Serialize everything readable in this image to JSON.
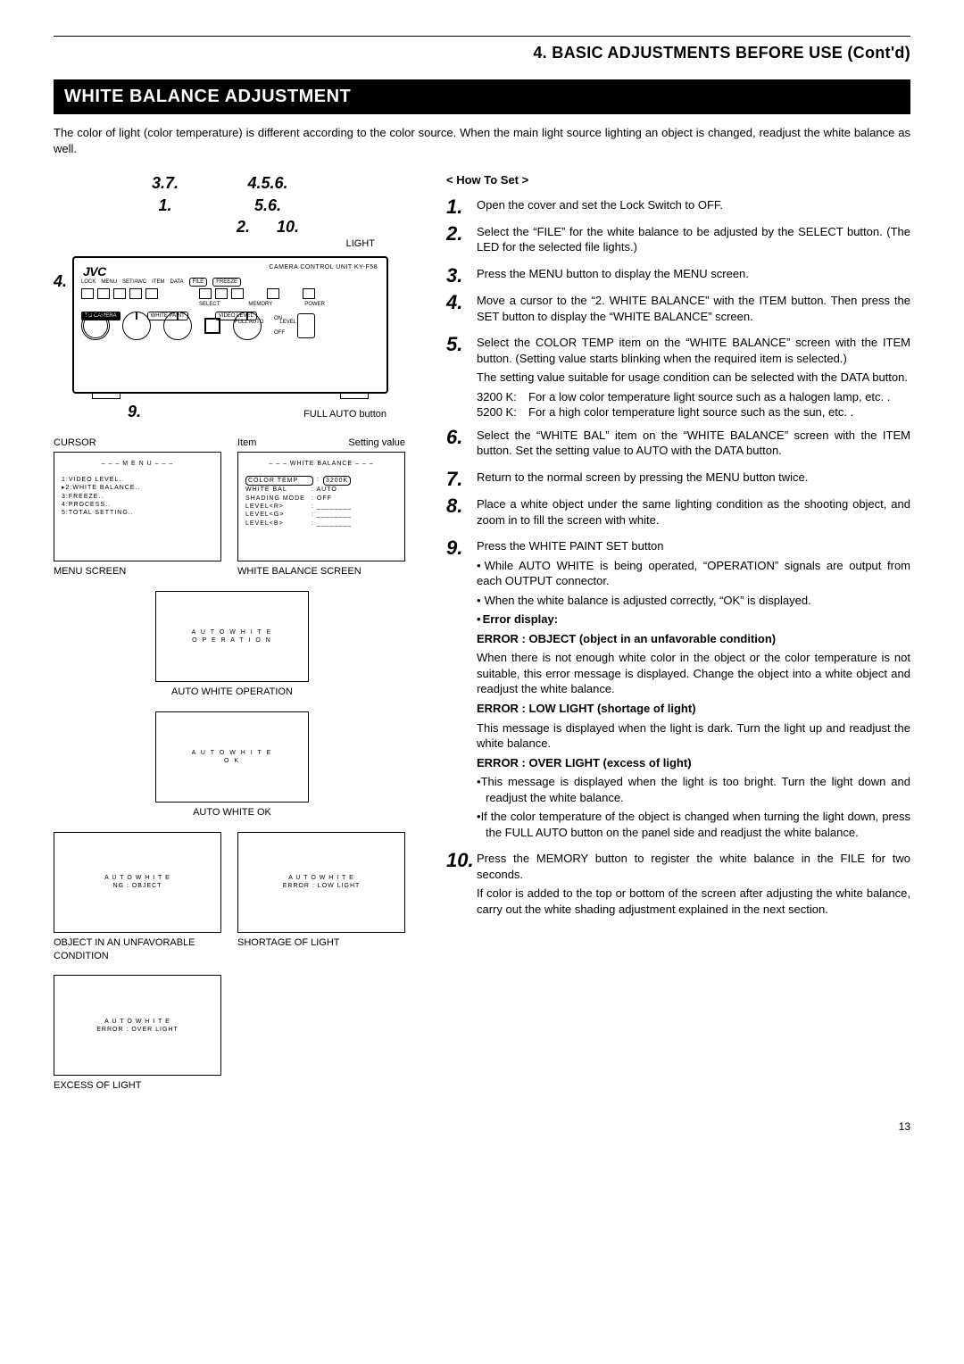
{
  "chapter": "4. BASIC ADJUSTMENTS BEFORE USE (Cont'd)",
  "section_title": "WHITE BALANCE ADJUSTMENT",
  "intro": "The color of light (color temperature) is different according to the color source. When the main light source lighting an object is changed, readjust the white balance as well.",
  "callouts": {
    "group_a": "3.7.",
    "group_a2": "1.",
    "group_b": "4.5.6.",
    "group_b2": "5.6.",
    "group_b3": "2.",
    "group_c": "10.",
    "light": "LIGHT",
    "left4": "4.",
    "below9": "9.",
    "full_auto": "FULL AUTO button"
  },
  "panel": {
    "logo": "JVC",
    "title": "CAMERA CONTROL UNIT  KY-F58",
    "file": "FILE",
    "freeze": "FREEZE",
    "lock": "LOCK",
    "menu": "MENU",
    "set": "SET/AWC",
    "item": "ITEM",
    "data": "DATA",
    "select": "SELECT",
    "memory": "MEMORY",
    "power": "POWER",
    "to_camera": "TO CAMERA",
    "white_paint": "WHITE PAINT",
    "video_level": "VIDEO LEVEL",
    "full_auto_l": "FULL AUTO",
    "level": "LEVEL",
    "on": "ON",
    "off": "OFF"
  },
  "screens": {
    "cursor_label": "CURSOR",
    "item_label": "Item",
    "setting_label": "Setting value",
    "menu_title": "– – – M E N U – – –",
    "menu_items": [
      "1:VIDEO LEVEL..",
      "▸2:WHITE BALANCE..",
      "3:FREEZE..",
      "4:PROCESS..",
      "5:TOTAL SETTING.."
    ],
    "menu_screen_label": "MENU SCREEN",
    "wb_title": "– – – WHITE BALANCE – – –",
    "wb_rows": [
      {
        "k": "COLOR TEMP",
        "v": "3200K",
        "boxed": true
      },
      {
        "k": "WHITE BAL",
        "v": ": AUTO"
      },
      {
        "k": "SHADING MODE",
        "v": ": OFF"
      },
      {
        "k": "LEVEL<R>",
        "v": ": ________"
      },
      {
        "k": "LEVEL<G>",
        "v": ": ________"
      },
      {
        "k": "LEVEL<B>",
        "v": ": ________"
      }
    ],
    "wb_screen_label": "WHITE BALANCE SCREEN",
    "auto_white": "A U T O   W H I T E",
    "operation": "O P E R A T I O N",
    "auto_white_op_label": "AUTO WHITE OPERATION",
    "ok": "O K",
    "auto_white_ok_label": "AUTO WHITE OK",
    "ng_object": "NG : OBJECT",
    "err_low": "ERROR : LOW LIGHT",
    "obj_label": "OBJECT IN AN UNFAVORABLE CONDITION",
    "short_label": "SHORTAGE OF LIGHT",
    "err_over": "ERROR : OVER LIGHT",
    "excess_label": "EXCESS OF LIGHT"
  },
  "howto_head": "< How To Set >",
  "steps": {
    "1": "Open the cover and set the Lock Switch to OFF.",
    "2": "Select the “FILE” for the white balance to be adjusted by the SELECT button. (The LED for the selected file lights.)",
    "3": "Press the MENU button to display the MENU screen.",
    "4": "Move a cursor to the “2. WHITE BALANCE” with the ITEM button. Then press the SET button to display the “WHITE BALANCE” screen.",
    "5a": "Select the COLOR TEMP item on the “WHITE BALANCE” screen with the ITEM button. (Setting value starts blinking when the required item is selected.)",
    "5b": "The setting value suitable for usage condition can be selected with the DATA button.",
    "5_3200": "For a low color temperature light source such as a halogen lamp, etc. .",
    "5_5200": "For a high color temperature light source such as the sun, etc. .",
    "6": "Select the “WHITE BAL” item on the “WHITE BALANCE” screen with the ITEM button. Set the setting value to AUTO with the DATA button.",
    "7": "Return to the normal screen by pressing the MENU button twice.",
    "8": "Place a white object under the same lighting condition as the shooting object, and zoom in to fill the screen with white.",
    "9": "Press the WHITE PAINT SET button",
    "9a": "While AUTO WHITE is being operated, “OPERATION” signals are output from each OUTPUT connector.",
    "9b": "When the white balance is adjusted correctly, “OK” is displayed.",
    "err_disp": "Error display:",
    "err_obj_h": "ERROR : OBJECT (object in an unfavorable condition)",
    "err_obj_t": "When there is not enough white color in the object or the color temperature is not suitable, this error message is displayed. Change the object into a white object and readjust the white balance.",
    "err_low_h": "ERROR : LOW LIGHT (shortage of light)",
    "err_low_t": "This message is displayed when the light is dark. Turn the light up and readjust the white balance.",
    "err_over_h": "ERROR : OVER LIGHT (excess of light)",
    "err_over_b1": "This message is displayed when the light is too bright. Turn the light down and readjust the white balance.",
    "err_over_b2": "If the color temperature of the object is changed when turning the light down, press the FULL AUTO button on the panel side and readjust the white balance.",
    "10a": "Press the MEMORY button to register the white balance in the FILE for two seconds.",
    "10b": "If color is added to the top or bottom of the screen after adjusting the white balance, carry out the white shading adjustment explained in the next section."
  },
  "k3200": "3200 K:",
  "k5200": "5200 K:",
  "page_num": "13"
}
